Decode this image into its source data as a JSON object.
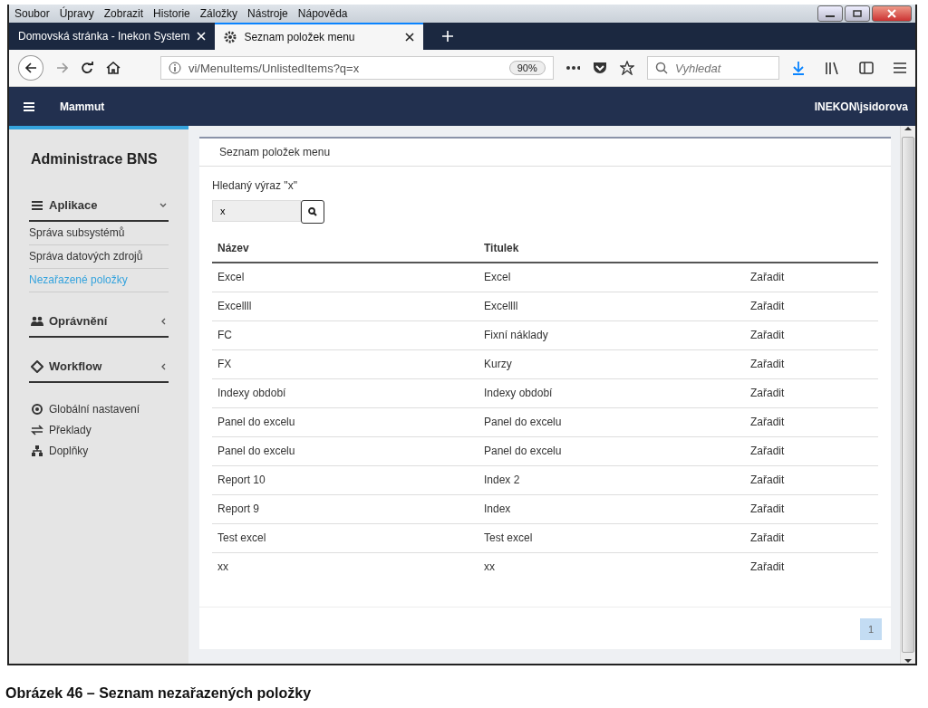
{
  "browser": {
    "menu": [
      "Soubor",
      "Úpravy",
      "Zobrazit",
      "Historie",
      "Záložky",
      "Nástroje",
      "Nápověda"
    ],
    "tabs": [
      {
        "label": "Domovská stránka - Inekon System",
        "selected": false
      },
      {
        "label": "Seznam položek menu",
        "selected": true
      }
    ],
    "address": "vi/MenuItems/UnlistedItems?q=x",
    "zoom": "90%",
    "search": {
      "placeholder": "Vyhledat"
    }
  },
  "app": {
    "brand": "Mammut",
    "user": "INEKON\\jsidorova"
  },
  "sidebar": {
    "title": "Administrace BNS",
    "sections": [
      {
        "label": "Aplikace",
        "expanded": true,
        "items": [
          {
            "label": "Správa subsystémů",
            "selected": false
          },
          {
            "label": "Správa datových zdrojů",
            "selected": false
          },
          {
            "label": "Nezařazené položky",
            "selected": true
          }
        ]
      },
      {
        "label": "Oprávnění",
        "expanded": false
      },
      {
        "label": "Workflow",
        "expanded": false
      }
    ],
    "links": [
      "Globální nastavení",
      "Překlady",
      "Doplňky"
    ]
  },
  "panel": {
    "title": "Seznam položek menu",
    "search_label": "Hledaný výraz \"x\"",
    "search_value": "x",
    "columns": [
      "Název",
      "Titulek"
    ],
    "rows": [
      [
        "Excel",
        "Excel",
        "Zařadit"
      ],
      [
        "Excellll",
        "Excellll",
        "Zařadit"
      ],
      [
        "FC",
        "Fixní náklady",
        "Zařadit"
      ],
      [
        "FX",
        "Kurzy",
        "Zařadit"
      ],
      [
        "Indexy období",
        "Indexy období",
        "Zařadit"
      ],
      [
        "Panel do excelu",
        "Panel do excelu",
        "Zařadit"
      ],
      [
        "Panel do excelu",
        "Panel do excelu",
        "Zařadit"
      ],
      [
        "Report 10",
        "Index 2",
        "Zařadit"
      ],
      [
        "Report 9",
        "Index",
        "Zařadit"
      ],
      [
        "Test excel",
        "Test excel",
        "Zařadit"
      ],
      [
        "xx",
        "xx",
        "Zařadit"
      ]
    ],
    "pagination": [
      {
        "label": "1",
        "selected": true
      }
    ]
  },
  "caption": "Obrázek 46 – Seznam nezařazených položky"
}
